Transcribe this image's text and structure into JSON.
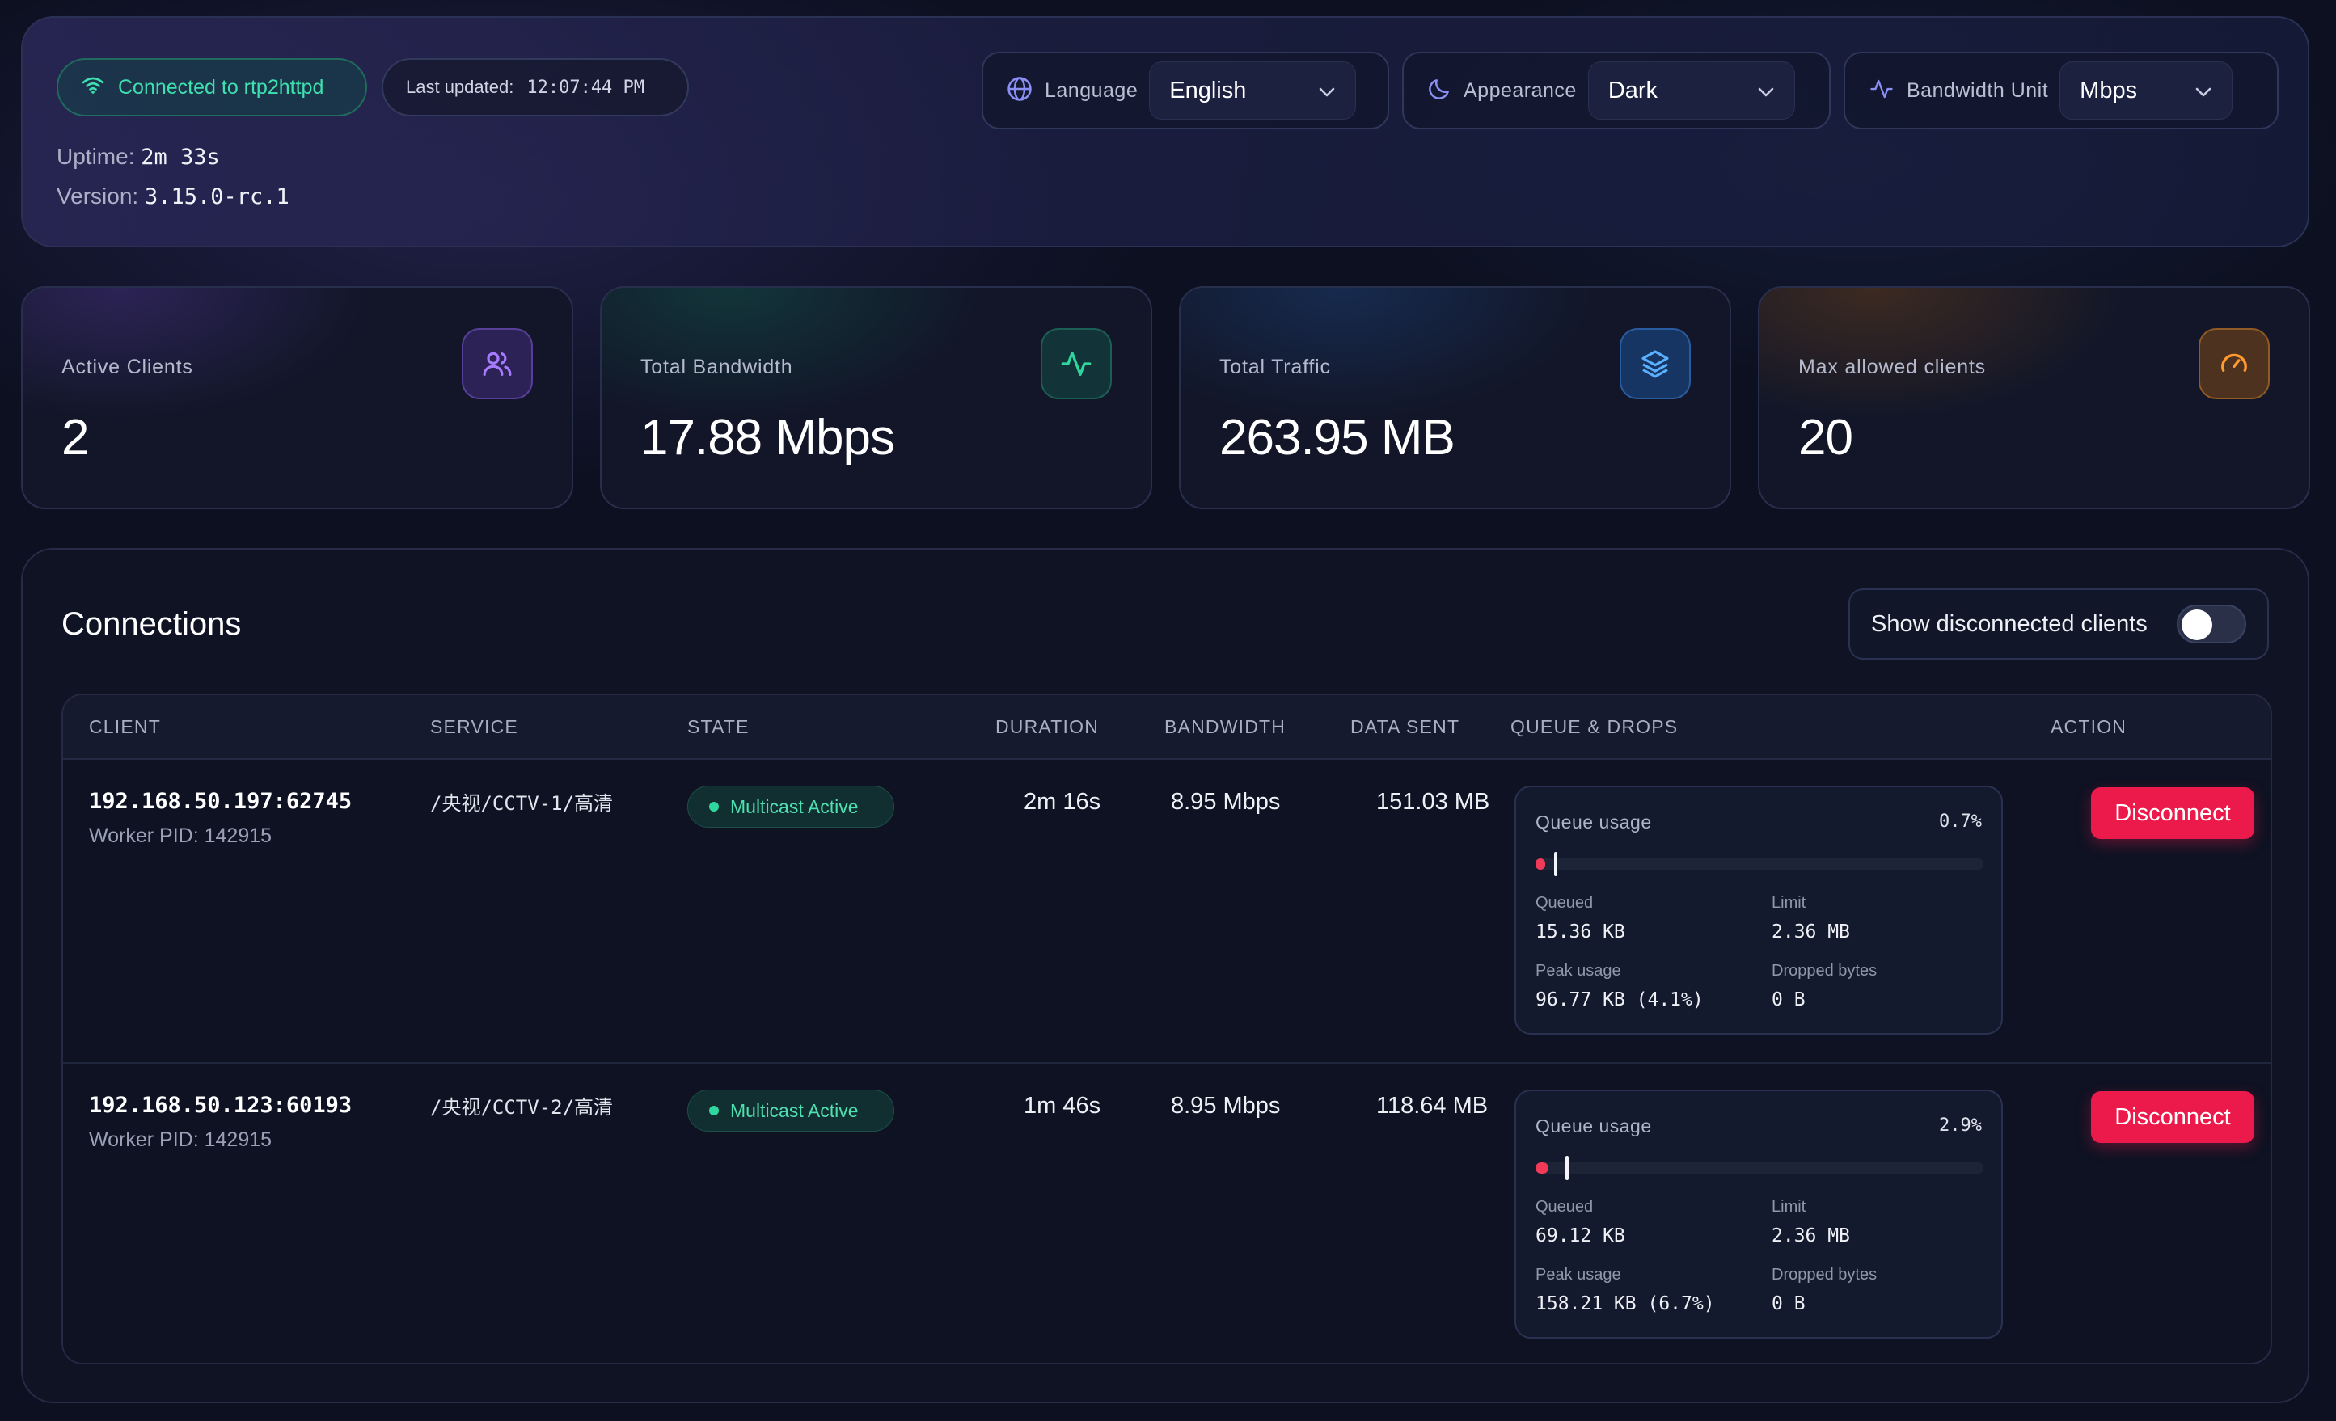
{
  "header": {
    "connection_status": "Connected to rtp2httpd",
    "last_updated_label": "Last updated:",
    "last_updated_time": "12:07:44 PM",
    "uptime_label": "Uptime:",
    "uptime_value": "2m 33s",
    "version_label": "Version:",
    "version_value": "3.15.0-rc.1",
    "language_label": "Language",
    "language_value": "English",
    "appearance_label": "Appearance",
    "appearance_value": "Dark",
    "bandwidth_unit_label": "Bandwidth Unit",
    "bandwidth_unit_value": "Mbps"
  },
  "stats": [
    {
      "label": "Active Clients",
      "value": "2",
      "icon": "users-icon",
      "accent": "#8b5cf6"
    },
    {
      "label": "Total Bandwidth",
      "value": "17.88 Mbps",
      "icon": "activity-icon",
      "accent": "#10b981"
    },
    {
      "label": "Total Traffic",
      "value": "263.95 MB",
      "icon": "layers-icon",
      "accent": "#3b82f6"
    },
    {
      "label": "Max allowed clients",
      "value": "20",
      "icon": "gauge-icon",
      "accent": "#f59e0b"
    }
  ],
  "connections": {
    "title": "Connections",
    "show_disconnected_label": "Show disconnected clients",
    "show_disconnected": false,
    "columns": [
      "CLIENT",
      "SERVICE",
      "STATE",
      "DURATION",
      "BANDWIDTH",
      "DATA SENT",
      "QUEUE & DROPS",
      "ACTION"
    ],
    "rows": [
      {
        "client": "192.168.50.197:62745",
        "worker_pid": "Worker PID: 142915",
        "service": "/央视/CCTV-1/高清",
        "state": "Multicast Active",
        "duration": "2m 16s",
        "bandwidth": "8.95 Mbps",
        "data_sent": "151.03 MB",
        "queue_usage_label": "Queue usage",
        "queue_usage_pct": "0.7%",
        "queue_fraction": 0.007,
        "peak_fraction": 0.041,
        "queued_label": "Queued",
        "queued": "15.36 KB",
        "limit_label": "Limit",
        "limit": "2.36 MB",
        "peak_label": "Peak usage",
        "peak": "96.77 KB (4.1%)",
        "dropped_label": "Dropped bytes",
        "dropped": "0 B",
        "action": "Disconnect"
      },
      {
        "client": "192.168.50.123:60193",
        "worker_pid": "Worker PID: 142915",
        "service": "/央视/CCTV-2/高清",
        "state": "Multicast Active",
        "duration": "1m 46s",
        "bandwidth": "8.95 Mbps",
        "data_sent": "118.64 MB",
        "queue_usage_label": "Queue usage",
        "queue_usage_pct": "2.9%",
        "queue_fraction": 0.029,
        "peak_fraction": 0.067,
        "queued_label": "Queued",
        "queued": "69.12 KB",
        "limit_label": "Limit",
        "limit": "2.36 MB",
        "peak_label": "Peak usage",
        "peak": "158.21 KB (6.7%)",
        "dropped_label": "Dropped bytes",
        "dropped": "0 B",
        "action": "Disconnect"
      }
    ]
  }
}
